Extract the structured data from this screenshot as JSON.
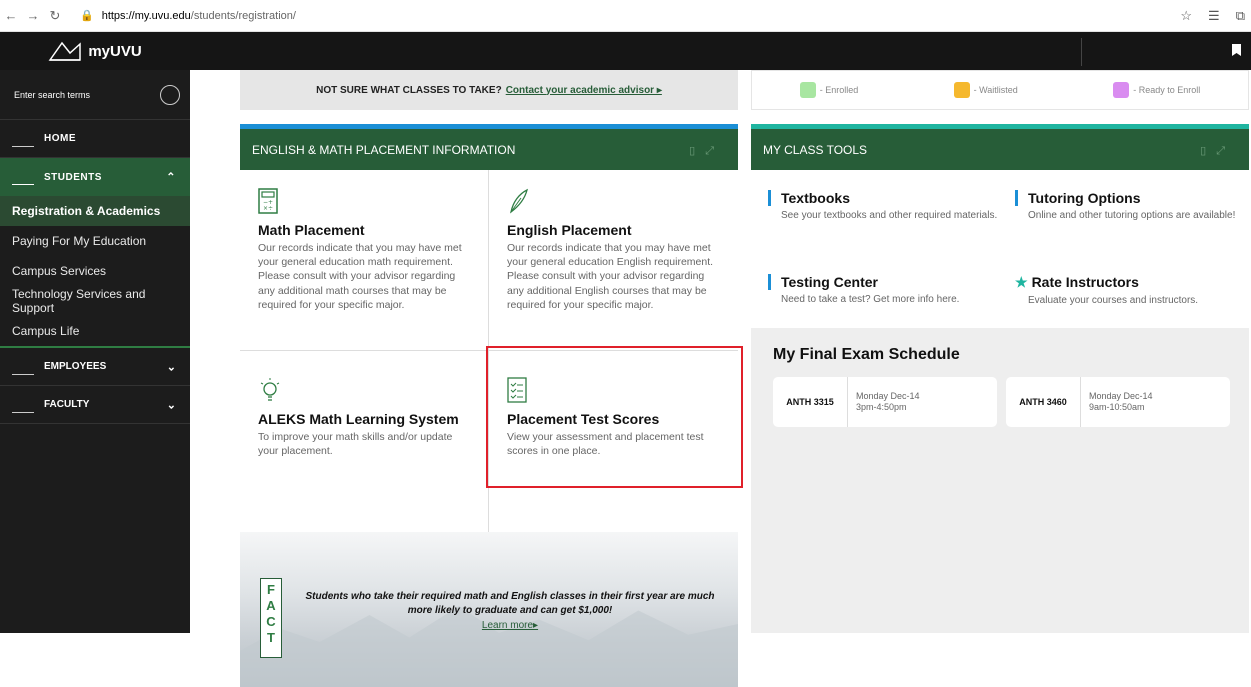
{
  "browser": {
    "url_host": "https://my.uvu.edu",
    "url_path": "/students/registration/"
  },
  "brand": {
    "name": "myUVU"
  },
  "sidebar": {
    "search_placeholder": "Enter search terms",
    "home": "HOME",
    "students": "STUDENTS",
    "students_items": [
      "Registration & Academics",
      "Paying For My Education",
      "Campus Services",
      "Technology Services and Support",
      "Campus Life"
    ],
    "employees": "EMPLOYEES",
    "faculty": "FACULTY"
  },
  "advisor": {
    "prompt": "NOT SURE WHAT CLASSES TO TAKE?",
    "link": "Contact your academic advisor ▸"
  },
  "legend": {
    "items": [
      {
        "label": "- Enrolled",
        "color": "#a8e6a1"
      },
      {
        "label": "- Waitlisted",
        "color": "#f5b82e"
      },
      {
        "label": "- Ready to Enroll",
        "color": "#d98cf0"
      }
    ]
  },
  "placement_panel": {
    "title": "ENGLISH & MATH PLACEMENT INFORMATION",
    "tiles": [
      {
        "title": "Math Placement",
        "desc": "Our records indicate that you may have met your general education math requirement. Please consult with your advisor regarding any additional math courses that may be required for your specific major."
      },
      {
        "title": "English Placement",
        "desc": "Our records indicate that you may have met your general education English requirement. Please consult with your advisor regarding any additional English courses that may be required for your specific major."
      },
      {
        "title": "ALEKS Math Learning System",
        "desc": "To improve your math skills and/or update your placement."
      },
      {
        "title": "Placement Test Scores",
        "desc": "View your assessment and placement test scores in one place."
      }
    ],
    "fact_badge": "FACT",
    "fact_text": "Students who take their required math and English classes in their first year are much more likely to graduate and can get $1,000!",
    "fact_link": "Learn more▸"
  },
  "tools_panel": {
    "title": "MY CLASS TOOLS",
    "tools": [
      {
        "title": "Textbooks",
        "desc": "See your textbooks and other required materials."
      },
      {
        "title": "Tutoring Options",
        "desc": "Online and other tutoring options are available!"
      },
      {
        "title": "Testing Center",
        "desc": "Need to take a test? Get more info here."
      },
      {
        "title": "Rate Instructors",
        "desc": "Evaluate your courses and instructors."
      }
    ],
    "exam_heading": "My Final Exam Schedule",
    "exams": [
      {
        "course": "ANTH 3315",
        "day": "Monday Dec-14",
        "time": "3pm-4:50pm"
      },
      {
        "course": "ANTH 3460",
        "day": "Monday Dec-14",
        "time": "9am-10:50am"
      }
    ]
  }
}
